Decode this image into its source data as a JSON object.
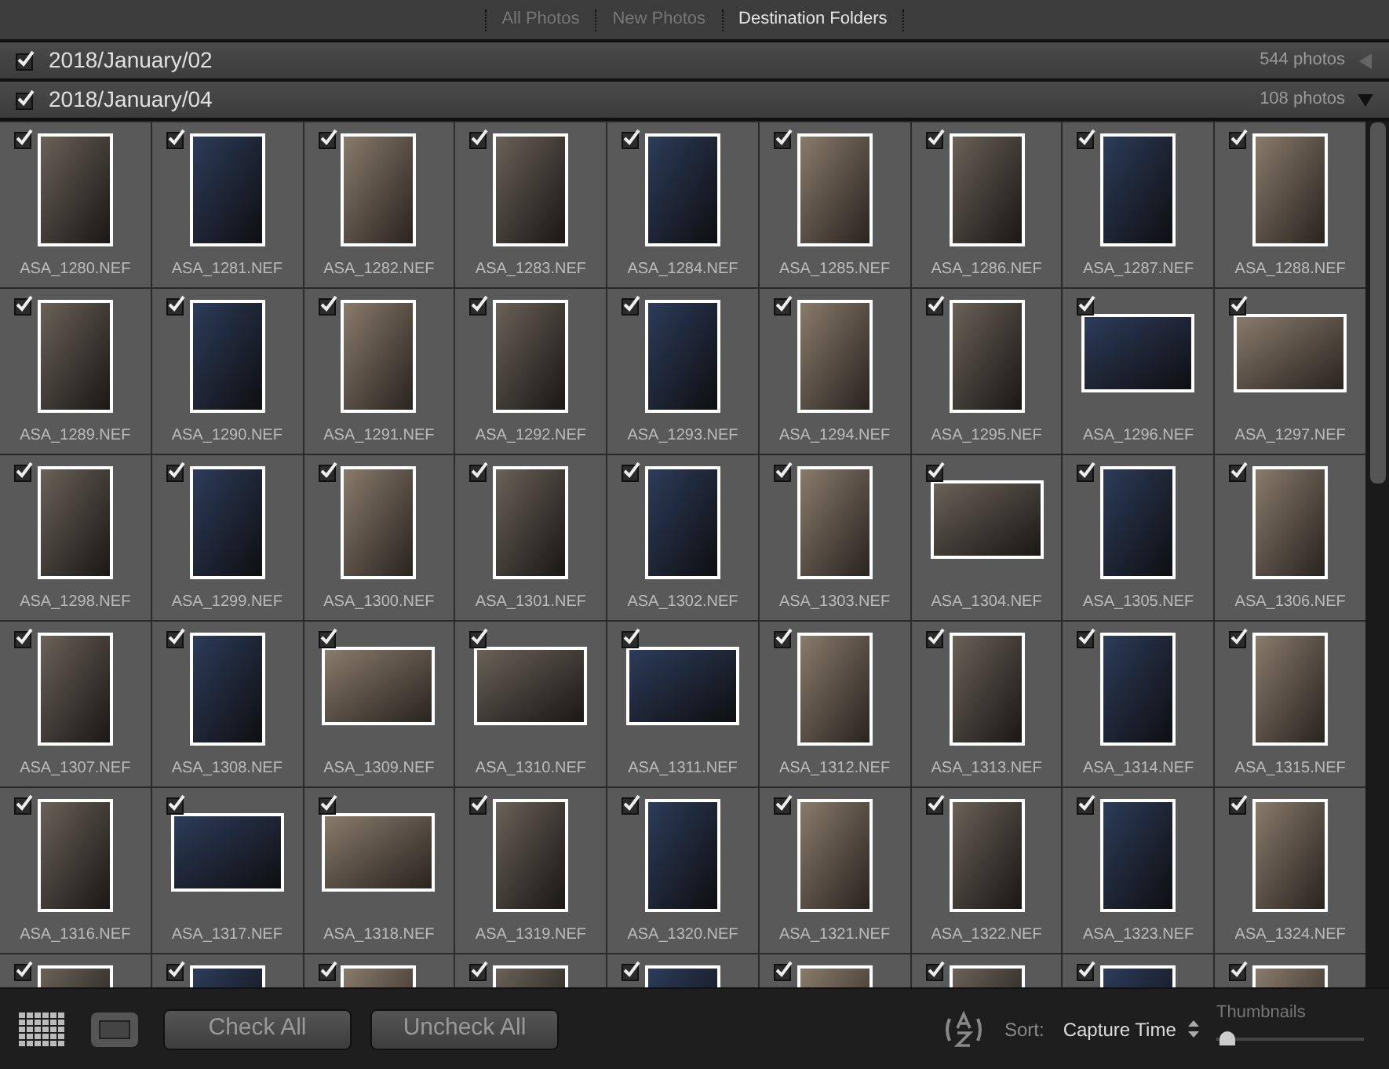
{
  "tabs": [
    {
      "label": "All Photos",
      "selected": false
    },
    {
      "label": "New Photos",
      "selected": false
    },
    {
      "label": "Destination Folders",
      "selected": true
    }
  ],
  "folders": [
    {
      "name": "2018/January/02",
      "count": "544 photos",
      "checked": true,
      "expanded": false
    },
    {
      "name": "2018/January/04",
      "count": "108 photos",
      "checked": true,
      "expanded": true
    }
  ],
  "photos": [
    {
      "label": "ASA_1280.NEF",
      "checked": true,
      "kind": "portrait"
    },
    {
      "label": "ASA_1281.NEF",
      "checked": true,
      "kind": "portrait"
    },
    {
      "label": "ASA_1282.NEF",
      "checked": true,
      "kind": "portrait"
    },
    {
      "label": "ASA_1283.NEF",
      "checked": true,
      "kind": "portrait"
    },
    {
      "label": "ASA_1284.NEF",
      "checked": true,
      "kind": "portrait"
    },
    {
      "label": "ASA_1285.NEF",
      "checked": true,
      "kind": "portrait"
    },
    {
      "label": "ASA_1286.NEF",
      "checked": true,
      "kind": "portrait"
    },
    {
      "label": "ASA_1287.NEF",
      "checked": true,
      "kind": "portrait"
    },
    {
      "label": "ASA_1288.NEF",
      "checked": true,
      "kind": "portrait"
    },
    {
      "label": "ASA_1289.NEF",
      "checked": true,
      "kind": "portrait"
    },
    {
      "label": "ASA_1290.NEF",
      "checked": true,
      "kind": "portrait"
    },
    {
      "label": "ASA_1291.NEF",
      "checked": true,
      "kind": "portrait"
    },
    {
      "label": "ASA_1292.NEF",
      "checked": true,
      "kind": "portrait"
    },
    {
      "label": "ASA_1293.NEF",
      "checked": true,
      "kind": "portrait"
    },
    {
      "label": "ASA_1294.NEF",
      "checked": true,
      "kind": "portrait"
    },
    {
      "label": "ASA_1295.NEF",
      "checked": true,
      "kind": "portrait"
    },
    {
      "label": "ASA_1296.NEF",
      "checked": true,
      "kind": "landscape"
    },
    {
      "label": "ASA_1297.NEF",
      "checked": true,
      "kind": "landscape"
    },
    {
      "label": "ASA_1298.NEF",
      "checked": true,
      "kind": "portrait"
    },
    {
      "label": "ASA_1299.NEF",
      "checked": true,
      "kind": "portrait"
    },
    {
      "label": "ASA_1300.NEF",
      "checked": true,
      "kind": "portrait"
    },
    {
      "label": "ASA_1301.NEF",
      "checked": true,
      "kind": "portrait"
    },
    {
      "label": "ASA_1302.NEF",
      "checked": true,
      "kind": "portrait"
    },
    {
      "label": "ASA_1303.NEF",
      "checked": true,
      "kind": "portrait"
    },
    {
      "label": "ASA_1304.NEF",
      "checked": true,
      "kind": "landscape"
    },
    {
      "label": "ASA_1305.NEF",
      "checked": true,
      "kind": "portrait"
    },
    {
      "label": "ASA_1306.NEF",
      "checked": true,
      "kind": "portrait"
    },
    {
      "label": "ASA_1307.NEF",
      "checked": true,
      "kind": "portrait"
    },
    {
      "label": "ASA_1308.NEF",
      "checked": true,
      "kind": "portrait"
    },
    {
      "label": "ASA_1309.NEF",
      "checked": true,
      "kind": "landscape"
    },
    {
      "label": "ASA_1310.NEF",
      "checked": true,
      "kind": "landscape"
    },
    {
      "label": "ASA_1311.NEF",
      "checked": true,
      "kind": "landscape"
    },
    {
      "label": "ASA_1312.NEF",
      "checked": true,
      "kind": "portrait"
    },
    {
      "label": "ASA_1313.NEF",
      "checked": true,
      "kind": "portrait"
    },
    {
      "label": "ASA_1314.NEF",
      "checked": true,
      "kind": "portrait"
    },
    {
      "label": "ASA_1315.NEF",
      "checked": true,
      "kind": "portrait"
    },
    {
      "label": "ASA_1316.NEF",
      "checked": true,
      "kind": "portrait"
    },
    {
      "label": "ASA_1317.NEF",
      "checked": true,
      "kind": "landscape"
    },
    {
      "label": "ASA_1318.NEF",
      "checked": true,
      "kind": "landscape"
    },
    {
      "label": "ASA_1319.NEF",
      "checked": true,
      "kind": "portrait"
    },
    {
      "label": "ASA_1320.NEF",
      "checked": true,
      "kind": "portrait"
    },
    {
      "label": "ASA_1321.NEF",
      "checked": true,
      "kind": "portrait"
    },
    {
      "label": "ASA_1322.NEF",
      "checked": true,
      "kind": "portrait"
    },
    {
      "label": "ASA_1323.NEF",
      "checked": true,
      "kind": "portrait"
    },
    {
      "label": "ASA_1324.NEF",
      "checked": true,
      "kind": "portrait"
    },
    {
      "checked": true,
      "kind": "portrait"
    },
    {
      "checked": true,
      "kind": "portrait"
    },
    {
      "checked": true,
      "kind": "portrait"
    },
    {
      "checked": true,
      "kind": "portrait"
    },
    {
      "checked": true,
      "kind": "portrait"
    },
    {
      "checked": true,
      "kind": "portrait"
    },
    {
      "checked": true,
      "kind": "portrait"
    },
    {
      "checked": true,
      "kind": "portrait"
    },
    {
      "checked": true,
      "kind": "portrait"
    }
  ],
  "toolbar": {
    "buttons": [
      "Check All",
      "Uncheck All"
    ],
    "sort_label": "Sort:",
    "sort_value": "Capture Time",
    "thumbnails_label": "Thumbnails",
    "thumbnails_size": {
      "level": 0.05
    }
  }
}
